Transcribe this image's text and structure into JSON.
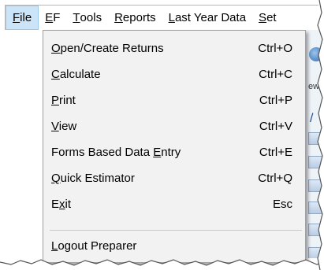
{
  "menubar": {
    "items": [
      {
        "label": "File",
        "mnemonic": "F",
        "rest": "ile",
        "active": true
      },
      {
        "label": "EF",
        "mnemonic": "E",
        "rest": "F"
      },
      {
        "label": "Tools",
        "mnemonic": "T",
        "rest": "ools"
      },
      {
        "label": "Reports",
        "mnemonic": "R",
        "rest": "eports"
      },
      {
        "label": "Last Year Data",
        "mnemonic": "L",
        "rest": "ast Year Data"
      },
      {
        "label": "Set",
        "mnemonic": "S",
        "rest": "et"
      }
    ]
  },
  "file_menu": {
    "items": [
      {
        "pre": "",
        "mnemonic": "O",
        "post": "pen/Create Returns",
        "shortcut": "Ctrl+O"
      },
      {
        "pre": "",
        "mnemonic": "C",
        "post": "alculate",
        "shortcut": "Ctrl+C"
      },
      {
        "pre": "",
        "mnemonic": "P",
        "post": "rint",
        "shortcut": "Ctrl+P"
      },
      {
        "pre": "",
        "mnemonic": "V",
        "post": "iew",
        "shortcut": "Ctrl+V"
      },
      {
        "pre": "Forms Based Data ",
        "mnemonic": "E",
        "post": "ntry",
        "shortcut": "Ctrl+E"
      },
      {
        "pre": "",
        "mnemonic": "Q",
        "post": "uick Estimator",
        "shortcut": "Ctrl+Q"
      },
      {
        "pre": "E",
        "mnemonic": "x",
        "post": "it",
        "shortcut": "Esc"
      }
    ],
    "logout": {
      "pre": "",
      "mnemonic": "L",
      "post": "ogout Preparer"
    }
  },
  "background": {
    "fragment_ew": "ew",
    "fragment_slash": "/"
  },
  "colors": {
    "active_menu_bg": "#cce4f7",
    "dropdown_bg": "#f2f2f2"
  }
}
